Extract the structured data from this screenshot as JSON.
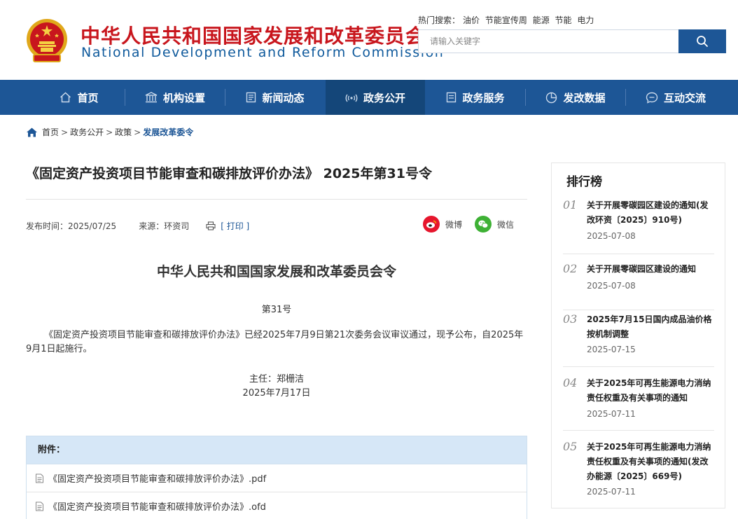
{
  "header": {
    "org_name_cn": "中华人民共和国国家发展和改革委员会",
    "org_name_en": "National Development and Reform Commission",
    "hot_label": "热门搜索：",
    "hot_terms": [
      "油价",
      "节能宣传周",
      "能源",
      "节能",
      "电力"
    ],
    "search_placeholder": "请输入关键字",
    "brand_color": "#c8161d",
    "nav_color": "#1d5696"
  },
  "nav": {
    "items": [
      {
        "label": "首页",
        "icon": "home-icon"
      },
      {
        "label": "机构设置",
        "icon": "institution-icon"
      },
      {
        "label": "新闻动态",
        "icon": "news-icon"
      },
      {
        "label": "政务公开",
        "icon": "signal-icon",
        "active": true
      },
      {
        "label": "政务服务",
        "icon": "service-icon"
      },
      {
        "label": "发改数据",
        "icon": "pie-chart-icon"
      },
      {
        "label": "互动交流",
        "icon": "chat-icon"
      }
    ]
  },
  "breadcrumb": {
    "items": [
      "首页",
      "政务公开",
      "政策"
    ],
    "current": "发展改革委令",
    "separator": ">"
  },
  "article": {
    "title": "《固定资产投资项目节能审查和碳排放评价办法》 2025年第31号令",
    "publish_label": "发布时间：",
    "publish_date": "2025/07/25",
    "source_label": "来源：",
    "source": "环资司",
    "print_label": "[ 打印 ]",
    "share_weibo": "微博",
    "share_wechat": "微信",
    "doc_heading": "中华人民共和国国家发展和改革委员会令",
    "doc_number": "第31号",
    "body": "《固定资产投资项目节能审查和碳排放评价办法》已经2025年7月9日第21次委务会议审议通过，现予公布，自2025年9月1日起施行。",
    "signer": "主任：郑栅洁",
    "sign_date": "2025年7月17日"
  },
  "attachments": {
    "header": "附件：",
    "files": [
      "《固定资产投资项目节能审查和碳排放评价办法》.pdf",
      "《固定资产投资项目节能审查和碳排放评价办法》.ofd"
    ]
  },
  "ranking": {
    "title": "排行榜",
    "items": [
      {
        "no": "01",
        "title": "关于开展零碳园区建设的通知(发改环资〔2025〕910号)",
        "date": "2025-07-08"
      },
      {
        "no": "02",
        "title": "关于开展零碳园区建设的通知",
        "date": "2025-07-08"
      },
      {
        "no": "03",
        "title": "2025年7月15日国内成品油价格按机制调整",
        "date": "2025-07-15"
      },
      {
        "no": "04",
        "title": "关于2025年可再生能源电力消纳责任权重及有关事项的通知",
        "date": "2025-07-11"
      },
      {
        "no": "05",
        "title": "关于2025年可再生能源电力消纳责任权重及有关事项的通知(发改办能源〔2025〕669号)",
        "date": "2025-07-11"
      }
    ]
  }
}
